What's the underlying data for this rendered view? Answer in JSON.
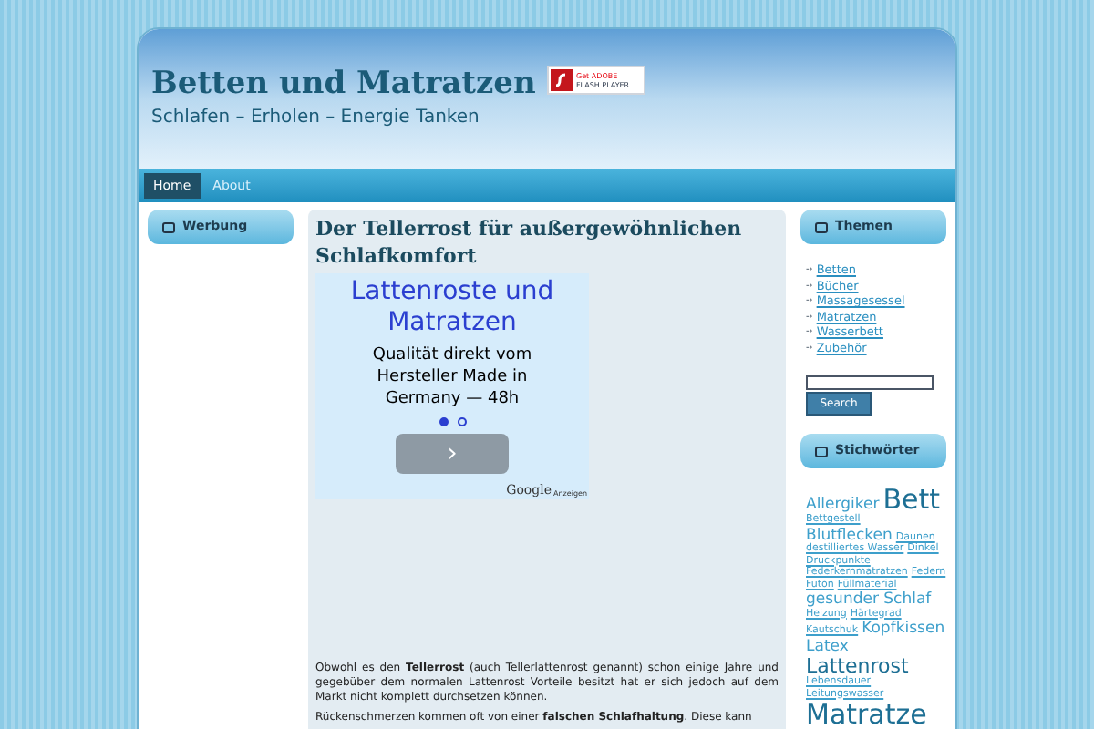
{
  "header": {
    "title": "Betten und Matratzen",
    "tagline": "Schlafen – Erholen – Energie Tanken",
    "flash_badge": {
      "line_1": "Get ADOBE",
      "line_2": "FLASH PLAYER"
    }
  },
  "nav": [
    {
      "label": "Home",
      "selected": true
    },
    {
      "label": "About",
      "selected": false
    }
  ],
  "left_sidebar": {
    "heading": "Werbung"
  },
  "article": {
    "title": "Der Tellerrost für außergewöhnlichen Schlafkomfort",
    "ad": {
      "headline": "Lattenroste und Matratzen",
      "text": "Qualität direkt vom Hersteller Made in Germany — 48h",
      "dots": [
        {
          "selected": true
        },
        {
          "selected": false
        }
      ],
      "button": "›",
      "attribution_brand": "Google",
      "attribution": "Anzeigen"
    },
    "paragraphs": [
      "Obwohl es den **Tellerrost** (auch Tellerlattenrost genannt) schon einige Jahre und gegebüber dem normalen Lattenrost Vorteile besitzt hat er sich jedoch auf dem Markt nicht komplett durchsetzen können.",
      "Rückenschmerzen kommen oft von einer **falschen Schlafhaltung**. Diese kann"
    ]
  },
  "right_sidebar": {
    "topics_heading": "Themen",
    "topics": [
      {
        "arrow": "-›",
        "label": "Betten"
      },
      {
        "arrow": "-›",
        "label": "Bücher"
      },
      {
        "arrow": "-›",
        "label": "Massagesessel"
      },
      {
        "arrow": "-›",
        "label": "Matratzen"
      },
      {
        "arrow": "-›",
        "label": "Wasserbett"
      },
      {
        "arrow": "-›",
        "label": "Zubehör"
      }
    ],
    "search_button": "Search",
    "tags_heading": "Stichwörter",
    "tags": [
      {
        "label": "Allergiker",
        "kind": "medium"
      },
      {
        "label": "Bett",
        "kind": "huge"
      },
      {
        "label": "Bettgestell",
        "kind": "small"
      },
      {
        "label": "Blutflecken",
        "kind": "medium"
      },
      {
        "label": "Daunen",
        "kind": "small"
      },
      {
        "label": "destilliertes Wasser",
        "kind": "small"
      },
      {
        "label": "Dinkel",
        "kind": "small"
      },
      {
        "label": "Druckpunkte",
        "kind": "small"
      },
      {
        "label": "Federkernmatratzen",
        "kind": "small"
      },
      {
        "label": "Federn",
        "kind": "small"
      },
      {
        "label": "Futon",
        "kind": "small"
      },
      {
        "label": "Füllmaterial",
        "kind": "small"
      },
      {
        "label": "gesunder Schlaf",
        "kind": "medium"
      },
      {
        "label": "Heizung",
        "kind": "small"
      },
      {
        "label": "Härtegrad",
        "kind": "small"
      },
      {
        "label": "Kautschuk",
        "kind": "small"
      },
      {
        "label": "Kopfkissen",
        "kind": "medium"
      },
      {
        "label": "Latex",
        "kind": "medium"
      },
      {
        "label": "Lattenrost",
        "kind": "large"
      },
      {
        "label": "Lebensdauer",
        "kind": "small"
      },
      {
        "label": "Leitungswasser",
        "kind": "small"
      },
      {
        "label": "Matratze",
        "kind": "huge"
      }
    ]
  }
}
